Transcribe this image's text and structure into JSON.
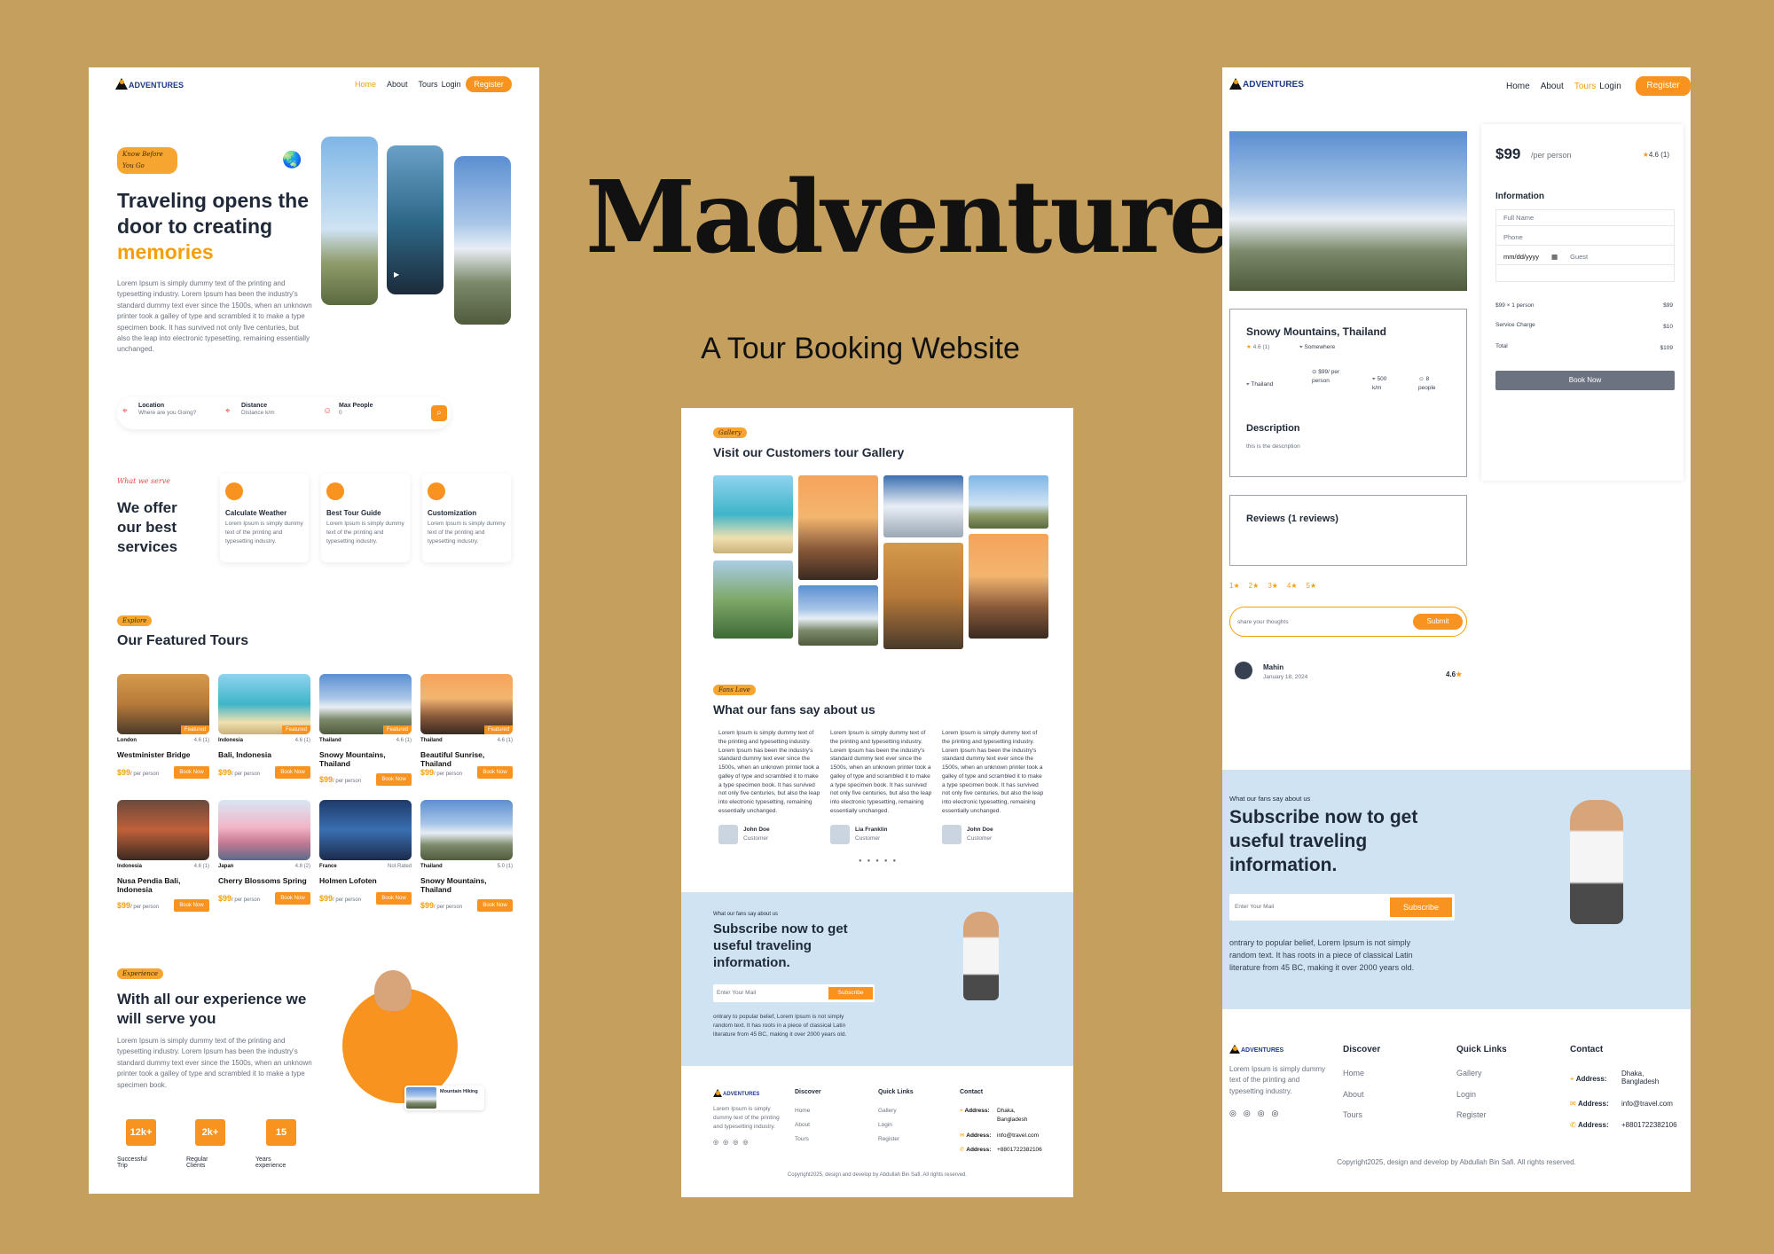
{
  "title": "Madventure",
  "subtitle": "A Tour Booking Website",
  "logo_text": "ADVENTURES",
  "colors": {
    "accent": "#f7931e",
    "background": "#c49f5e",
    "subscribe_bg": "#cfe3f3"
  },
  "home": {
    "nav": {
      "home": "Home",
      "about": "About",
      "tours": "Tours",
      "login": "Login",
      "register": "Register"
    },
    "hero_tag": "Know Before You Go",
    "hero_title_line1": "Traveling opens the",
    "hero_title_line2": "door to creating",
    "hero_title_highlight": "memories",
    "hero_text": "Lorem Ipsum is simply dummy text of the printing and typesetting industry. Lorem Ipsum has been the industry's standard dummy text ever since the 1500s, when an unknown printer took a galley of type and scrambled it to make a type specimen book. It has survived not only five centuries, but also the leap into electronic typesetting, remaining essentially unchanged.",
    "search": {
      "location_label": "Location",
      "location_placeholder": "Where are you Going?",
      "distance_label": "Distance",
      "distance_placeholder": "Distance k/m",
      "people_label": "Max People",
      "people_placeholder": "0"
    },
    "services_tag": "What we serve",
    "services_title": "We offer our best services",
    "services": [
      {
        "title": "Calculate Weather",
        "text": "Lorem Ipsum is simply dummy text of the printing and typesetting industry."
      },
      {
        "title": "Best Tour Guide",
        "text": "Lorem Ipsum is simply dummy text of the printing and typesetting industry."
      },
      {
        "title": "Customization",
        "text": "Lorem Ipsum is simply dummy text of the printing and typesetting industry."
      }
    ],
    "featured_tag": "Explore",
    "featured_title": "Our Featured Tours",
    "featured_label": "Featured",
    "book_label": "Book Now",
    "per_person": "/ per person",
    "tours": [
      {
        "loc": "London",
        "rating": "4.6 (1)",
        "name": "Westminister Bridge",
        "price": "$99"
      },
      {
        "loc": "Indonesia",
        "rating": "4.6 (1)",
        "name": "Bali, Indonesia",
        "price": "$99"
      },
      {
        "loc": "Thailand",
        "rating": "4.6 (1)",
        "name": "Snowy Mountains, Thailand",
        "price": "$99"
      },
      {
        "loc": "Thailand",
        "rating": "4.6 (1)",
        "name": "Beautiful Sunrise, Thailand",
        "price": "$99"
      },
      {
        "loc": "Indonesia",
        "rating": "4.6 (1)",
        "name": "Nusa Pendia Bali, Indonesia",
        "price": "$99"
      },
      {
        "loc": "Japan",
        "rating": "4.8 (2)",
        "name": "Cherry Blossoms Spring",
        "price": "$99"
      },
      {
        "loc": "France",
        "rating": "Not Rated",
        "name": "Holmen Lofoten",
        "price": "$99"
      },
      {
        "loc": "Thailand",
        "rating": "5.0 (1)",
        "name": "Snowy Mountains, Thailand",
        "price": "$99"
      }
    ],
    "experience_tag": "Experience",
    "experience_title": "With all our experience we will serve you",
    "experience_text": "Lorem Ipsum is simply dummy text of the printing and typesetting industry. Lorem Ipsum has been the industry's standard dummy text ever since the 1500s, when an unknown printer took a galley of type and scrambled it to make a type specimen book.",
    "stats": [
      {
        "value": "12k+",
        "label": "Successful Trip"
      },
      {
        "value": "2k+",
        "label": "Regular Clients"
      },
      {
        "value": "15",
        "label": "Years experience"
      }
    ],
    "mountain_hiking": "Mountain Hiking"
  },
  "gallery": {
    "tag": "Gallery",
    "title": "Visit our Customers tour Gallery",
    "fans_tag": "Fans Love",
    "fans_title": "What our fans say about us",
    "testimonial_text": "Lorem Ipsum is simply dummy text of the printing and typesetting industry. Lorem Ipsum has been the industry's standard dummy text ever since the 1500s, when an unknown printer took a galley of type and scrambled it to make a type specimen book. It has survived not only five centuries, but also the leap into electronic typesetting, remaining essentially unchanged.",
    "people": [
      {
        "name": "John Doe",
        "role": "Customer"
      },
      {
        "name": "Lia Franklin",
        "role": "Customer"
      },
      {
        "name": "John Doe",
        "role": "Customer"
      }
    ]
  },
  "subscribe": {
    "kicker": "What our fans say about us",
    "title": "Subscribe now to get useful traveling information.",
    "placeholder": "Enter Your Mail",
    "button": "Subscribe",
    "text": "ontrary to popular belief, Lorem Ipsum is not simply random text. It has roots in a piece of classical Latin literature from 45 BC, making it over 2000 years old."
  },
  "footer": {
    "about": "Lorem Ipsum is simply dummy text of the printing and typesetting industry.",
    "discover": "Discover",
    "quick_links": "Quick Links",
    "contact": "Contact",
    "discover_items": [
      "Home",
      "About",
      "Tours"
    ],
    "quick_items": [
      "Gallery",
      "Login",
      "Register"
    ],
    "address_label": "Address:",
    "address_value": "Dhaka, Bangladesh",
    "email_value": "info@travel.com",
    "phone_value": "+8801722382106",
    "copyright": "Copyright2025, design and develop by Abdullah Bin Safi. All rights reserved."
  },
  "detail": {
    "price": "$99",
    "per_person": "/per person",
    "rating": "4.6 (1)",
    "info_title": "Information",
    "full_name": "Full Name",
    "phone": "Phone",
    "date": "mm/dd/yyyy",
    "guest": "Guest",
    "calc_line": "$99 × 1 person",
    "calc_value": "$99",
    "service_label": "Service Charge",
    "service_value": "$10",
    "total_label": "Total",
    "total_value": "$109",
    "book_button": "Book Now",
    "tour_title": "Snowy Mountains, Thailand",
    "tour_rating": "4.6 (1)",
    "tour_address": "Somewhere",
    "tour_city": "Thailand",
    "tour_price": "$99/ per person",
    "tour_distance": "500 k/m",
    "tour_people": "8 people",
    "desc_title": "Description",
    "desc_text": "this is the description",
    "reviews_title": "Reviews (1 reviews)",
    "stars": [
      "1★",
      "2★",
      "3★",
      "4★",
      "5★"
    ],
    "review_placeholder": "share your thoughts",
    "review_submit": "Submit",
    "reviewer": "Mahin",
    "review_date": "January 18, 2024",
    "review_rating": "4.6"
  }
}
